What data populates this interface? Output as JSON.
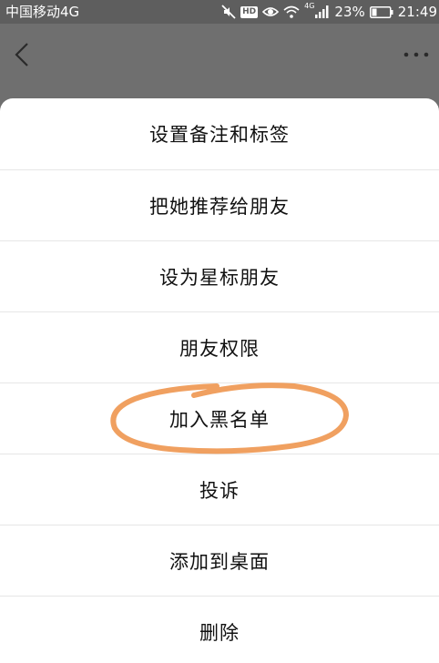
{
  "status_bar": {
    "carrier": "中国移动4G",
    "hd_label": "HD",
    "network_tag": "4G",
    "battery_percent": "23%",
    "time": "21:49",
    "icons": [
      "mute-icon",
      "hd-icon",
      "eye-icon",
      "wifi-icon",
      "signal-icon",
      "battery-icon"
    ]
  },
  "nav": {
    "back_icon": "chevron-left-icon",
    "more_icon": "more-dots-icon"
  },
  "menu": {
    "items": [
      {
        "label": "设置备注和标签"
      },
      {
        "label": "把她推荐给朋友"
      },
      {
        "label": "设为星标朋友"
      },
      {
        "label": "朋友权限"
      },
      {
        "label": "加入黑名单"
      },
      {
        "label": "投诉"
      },
      {
        "label": "添加到桌面"
      },
      {
        "label": "删除"
      }
    ]
  },
  "annotation": {
    "highlighted_item": "加入黑名单",
    "color": "#f0a060"
  },
  "colors": {
    "overlay": "#6f6f6f",
    "status_bar": "#5e5e5e",
    "sheet": "#ffffff",
    "divider": "#e6e6e6",
    "text": "#111111"
  }
}
